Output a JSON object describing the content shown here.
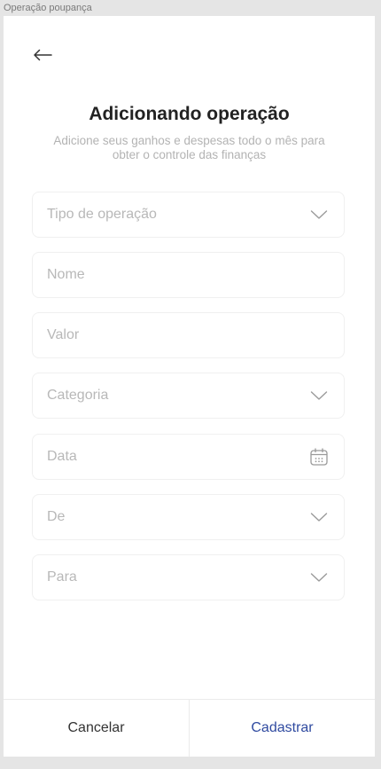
{
  "frame": {
    "label": "Operação poupança"
  },
  "header": {
    "back_icon": "arrow-left-icon",
    "title": "Adicionando operação",
    "subtitle": "Adicione seus ganhos e despesas todo o mês para obter o controle das finanças"
  },
  "form": {
    "fields": [
      {
        "placeholder": "Tipo de operação",
        "icon": "chevron-down-icon"
      },
      {
        "placeholder": "Nome",
        "icon": ""
      },
      {
        "placeholder": "Valor",
        "icon": ""
      },
      {
        "placeholder": "Categoria",
        "icon": "chevron-down-icon"
      },
      {
        "placeholder": "Data",
        "icon": "calendar-icon"
      },
      {
        "placeholder": "De",
        "icon": "chevron-down-icon"
      },
      {
        "placeholder": "Para",
        "icon": "chevron-down-icon"
      }
    ]
  },
  "footer": {
    "cancel_label": "Cancelar",
    "submit_label": "Cadastrar"
  },
  "colors": {
    "accent": "#2f4aa0",
    "placeholder": "#b8b8b8",
    "border": "#f0f0f0"
  }
}
